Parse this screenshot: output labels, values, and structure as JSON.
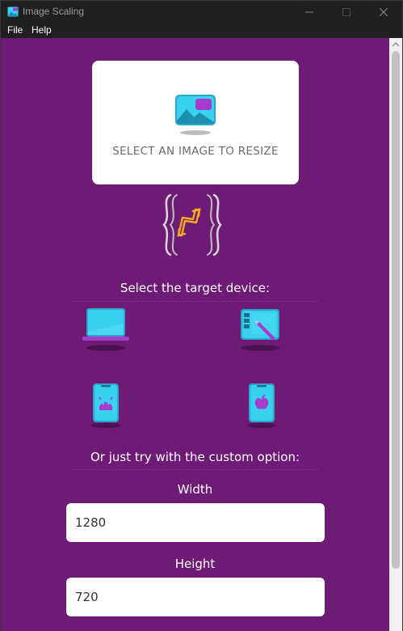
{
  "window": {
    "title": "Image Scaling"
  },
  "menu": {
    "file": "File",
    "help": "Help"
  },
  "image_card": {
    "label": "SELECT AN IMAGE TO RESIZE"
  },
  "labels": {
    "target_device": "Select the target device:",
    "custom_option": "Or just try with the custom option:",
    "width": "Width",
    "height": "Height"
  },
  "devices": [
    {
      "name": "laptop",
      "icon": "laptop-icon"
    },
    {
      "name": "tablet",
      "icon": "tablet-icon"
    },
    {
      "name": "android",
      "icon": "android-phone-icon"
    },
    {
      "name": "apple",
      "icon": "apple-phone-icon"
    }
  ],
  "inputs": {
    "width_value": "1280",
    "height_value": "720"
  },
  "colors": {
    "background": "#6d1b74",
    "card": "#ffffff",
    "device_cyan": "#3ad0ef",
    "accent_purple": "#a63ccb",
    "logo_orange": "#f5a623",
    "titlebar": "#202020"
  }
}
